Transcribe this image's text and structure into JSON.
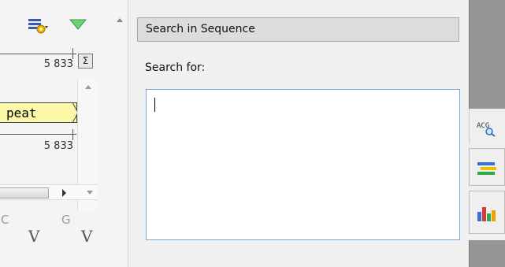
{
  "sequence_view": {
    "coord_top": "5 833",
    "coord_mid": "5 833",
    "sigma_label": "Σ",
    "feature_label": "peat",
    "bases": [
      "C",
      "G"
    ],
    "variant_marks": [
      "V",
      "V"
    ]
  },
  "search_panel": {
    "header": "Search in Sequence",
    "search_for_label": "Search for:",
    "search_value": ""
  },
  "side_toolbar": {
    "search_icon_text": "ACG",
    "items": [
      "search-sequence",
      "annotations",
      "statistics"
    ]
  },
  "colors": {
    "feature_fill": "#fbf9a8",
    "textarea_border": "#7aa7d8",
    "panel_header_bg": "#dcdcdc",
    "side_dark": "#959595"
  }
}
